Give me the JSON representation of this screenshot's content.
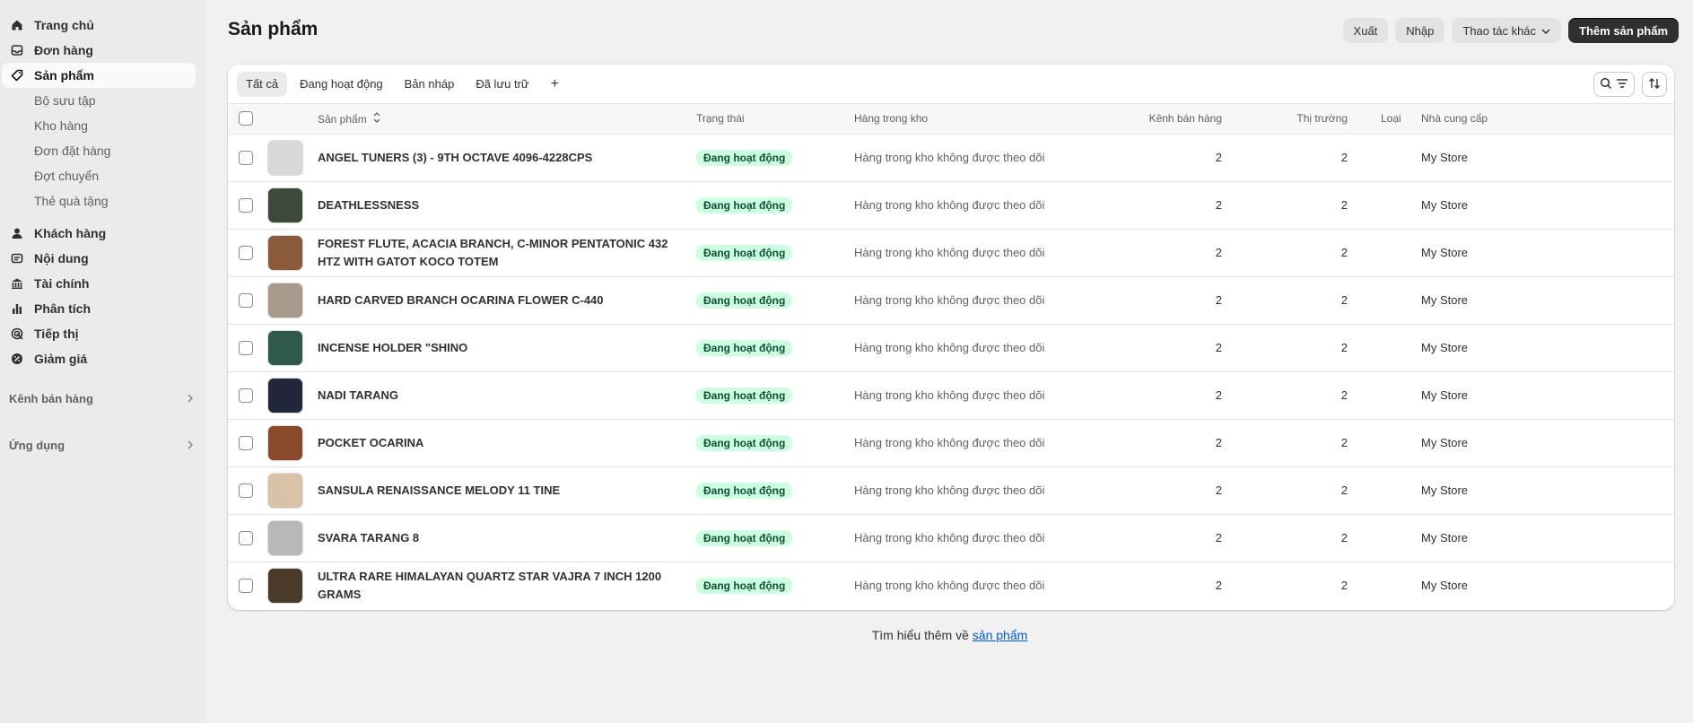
{
  "sidebar": {
    "items": [
      {
        "label": "Trang chủ",
        "icon": "home-icon"
      },
      {
        "label": "Đơn hàng",
        "icon": "inbox-icon"
      },
      {
        "label": "Sản phẩm",
        "icon": "tag-icon"
      }
    ],
    "sub_items": [
      "Bộ sưu tập",
      "Kho hàng",
      "Đơn đặt hàng",
      "Đợt chuyển",
      "Thẻ quà tặng"
    ],
    "items2": [
      {
        "label": "Khách hàng",
        "icon": "person-icon"
      },
      {
        "label": "Nội dung",
        "icon": "content-icon"
      },
      {
        "label": "Tài chính",
        "icon": "bank-icon"
      },
      {
        "label": "Phân tích",
        "icon": "chart-icon"
      },
      {
        "label": "Tiếp thị",
        "icon": "target-icon"
      },
      {
        "label": "Giảm giá",
        "icon": "discount-icon"
      }
    ],
    "sections": [
      "Kênh bán hàng",
      "Ứng dụng"
    ]
  },
  "header": {
    "title": "Sản phẩm",
    "export_label": "Xuất",
    "import_label": "Nhập",
    "more_label": "Thao tác khác",
    "add_label": "Thêm sản phẩm"
  },
  "tabs": [
    "Tất cả",
    "Đang hoạt động",
    "Bản nháp",
    "Đã lưu trữ"
  ],
  "add_tab": "+",
  "columns": {
    "product": "Sản phẩm",
    "status": "Trạng thái",
    "inventory": "Hàng trong kho",
    "channels": "Kênh bán hàng",
    "markets": "Thị trường",
    "type": "Loại",
    "vendor": "Nhà cung cấp"
  },
  "rows": [
    {
      "name": "ANGEL TUNERS (3) - 9TH OCTAVE 4096-4228CPS",
      "status": "Đang hoạt động",
      "inventory": "Hàng trong kho không được theo dõi",
      "channels": "2",
      "markets": "2",
      "type": "",
      "vendor": "My Store",
      "thumb_color": "#d8d8d8"
    },
    {
      "name": "DEATHLESSNESS",
      "status": "Đang hoạt động",
      "inventory": "Hàng trong kho không được theo dõi",
      "channels": "2",
      "markets": "2",
      "type": "",
      "vendor": "My Store",
      "thumb_color": "#3d4a3a"
    },
    {
      "name": "FOREST FLUTE, ACACIA BRANCH, C-MINOR PENTATONIC 432 HTZ WITH GATOT KOCO TOTEM",
      "status": "Đang hoạt động",
      "inventory": "Hàng trong kho không được theo dõi",
      "channels": "2",
      "markets": "2",
      "type": "",
      "vendor": "My Store",
      "thumb_color": "#8b5a3c"
    },
    {
      "name": "HARD CARVED BRANCH OCARINA FLOWER C-440",
      "status": "Đang hoạt động",
      "inventory": "Hàng trong kho không được theo dõi",
      "channels": "2",
      "markets": "2",
      "type": "",
      "vendor": "My Store",
      "thumb_color": "#a89a8a"
    },
    {
      "name": "INCENSE HOLDER \"SHINO",
      "status": "Đang hoạt động",
      "inventory": "Hàng trong kho không được theo dõi",
      "channels": "2",
      "markets": "2",
      "type": "",
      "vendor": "My Store",
      "thumb_color": "#2f5a4a"
    },
    {
      "name": "NADI TARANG",
      "status": "Đang hoạt động",
      "inventory": "Hàng trong kho không được theo dõi",
      "channels": "2",
      "markets": "2",
      "type": "",
      "vendor": "My Store",
      "thumb_color": "#22263a"
    },
    {
      "name": "POCKET OCARINA",
      "status": "Đang hoạt động",
      "inventory": "Hàng trong kho không được theo dõi",
      "channels": "2",
      "markets": "2",
      "type": "",
      "vendor": "My Store",
      "thumb_color": "#8a4a2a"
    },
    {
      "name": "SANSULA RENAISSANCE MELODY 11 TINE",
      "status": "Đang hoạt động",
      "inventory": "Hàng trong kho không được theo dõi",
      "channels": "2",
      "markets": "2",
      "type": "",
      "vendor": "My Store",
      "thumb_color": "#d9c2a8"
    },
    {
      "name": "SVARA TARANG 8",
      "status": "Đang hoạt động",
      "inventory": "Hàng trong kho không được theo dõi",
      "channels": "2",
      "markets": "2",
      "type": "",
      "vendor": "My Store",
      "thumb_color": "#b8b8b8"
    },
    {
      "name": "ULTRA RARE HIMALAYAN QUARTZ STAR VAJRA 7 INCH 1200 GRAMS",
      "status": "Đang hoạt động",
      "inventory": "Hàng trong kho không được theo dõi",
      "channels": "2",
      "markets": "2",
      "type": "",
      "vendor": "My Store",
      "thumb_color": "#4a3a2a"
    }
  ],
  "footer": {
    "text": "Tìm hiểu thêm về ",
    "link": "sản phẩm"
  }
}
